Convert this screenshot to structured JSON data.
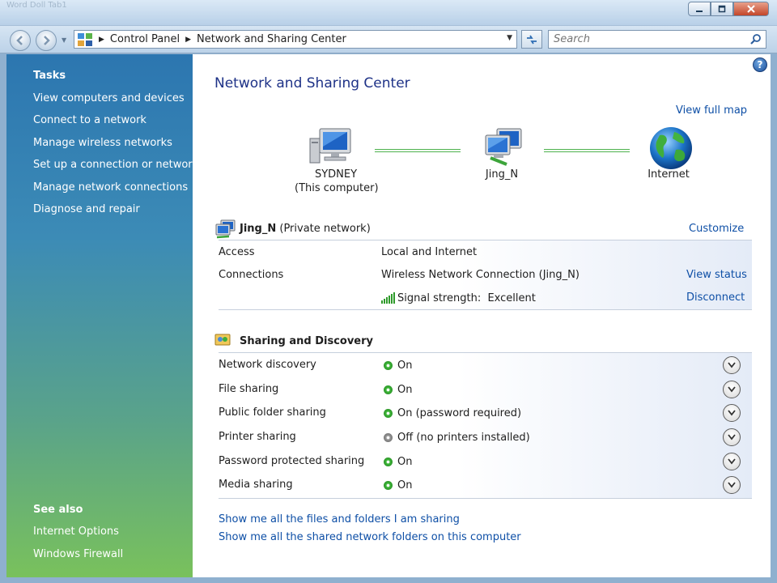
{
  "window": {
    "title": "Network and Sharing Center",
    "ghost_title": "Word Doll  Tab1"
  },
  "address_bar": {
    "breadcrumb": [
      "Control Panel",
      "Network and Sharing Center"
    ],
    "search_placeholder": "Search"
  },
  "sidebar": {
    "tasks_heading": "Tasks",
    "tasks": [
      "View computers and devices",
      "Connect to a network",
      "Manage wireless networks",
      "Set up a connection or network",
      "Manage network connections",
      "Diagnose and repair"
    ],
    "see_also_heading": "See also",
    "see_also": [
      "Internet Options",
      "Windows Firewall"
    ]
  },
  "main": {
    "title": "Network and Sharing Center",
    "view_full_map": "View full map",
    "map": {
      "computer_name": "SYDNEY",
      "computer_sub": "(This computer)",
      "network_name": "Jing_N",
      "internet": "Internet"
    },
    "network": {
      "name": "Jing_N",
      "type": "(Private network)",
      "customize": "Customize",
      "access_label": "Access",
      "access_value": "Local and Internet",
      "connections_label": "Connections",
      "connection_value": "Wireless Network Connection (Jing_N)",
      "view_status": "View status",
      "signal_label": "Signal strength:",
      "signal_value": "Excellent",
      "disconnect": "Disconnect"
    },
    "sharing": {
      "heading": "Sharing and Discovery",
      "rows": [
        {
          "label": "Network discovery",
          "state": "On",
          "on": true
        },
        {
          "label": "File sharing",
          "state": "On",
          "on": true
        },
        {
          "label": "Public folder sharing",
          "state": "On (password required)",
          "on": true
        },
        {
          "label": "Printer sharing",
          "state": "Off (no printers installed)",
          "on": false
        },
        {
          "label": "Password protected sharing",
          "state": "On",
          "on": true
        },
        {
          "label": "Media sharing",
          "state": "On",
          "on": true
        }
      ]
    },
    "bottom_links": [
      "Show me all the files and folders I am sharing",
      "Show me all the shared network folders on this computer"
    ]
  },
  "colors": {
    "link": "#0e4fa6",
    "title": "#1e3287",
    "status_on": "#3fb83a",
    "status_off": "#9a9a9a"
  }
}
